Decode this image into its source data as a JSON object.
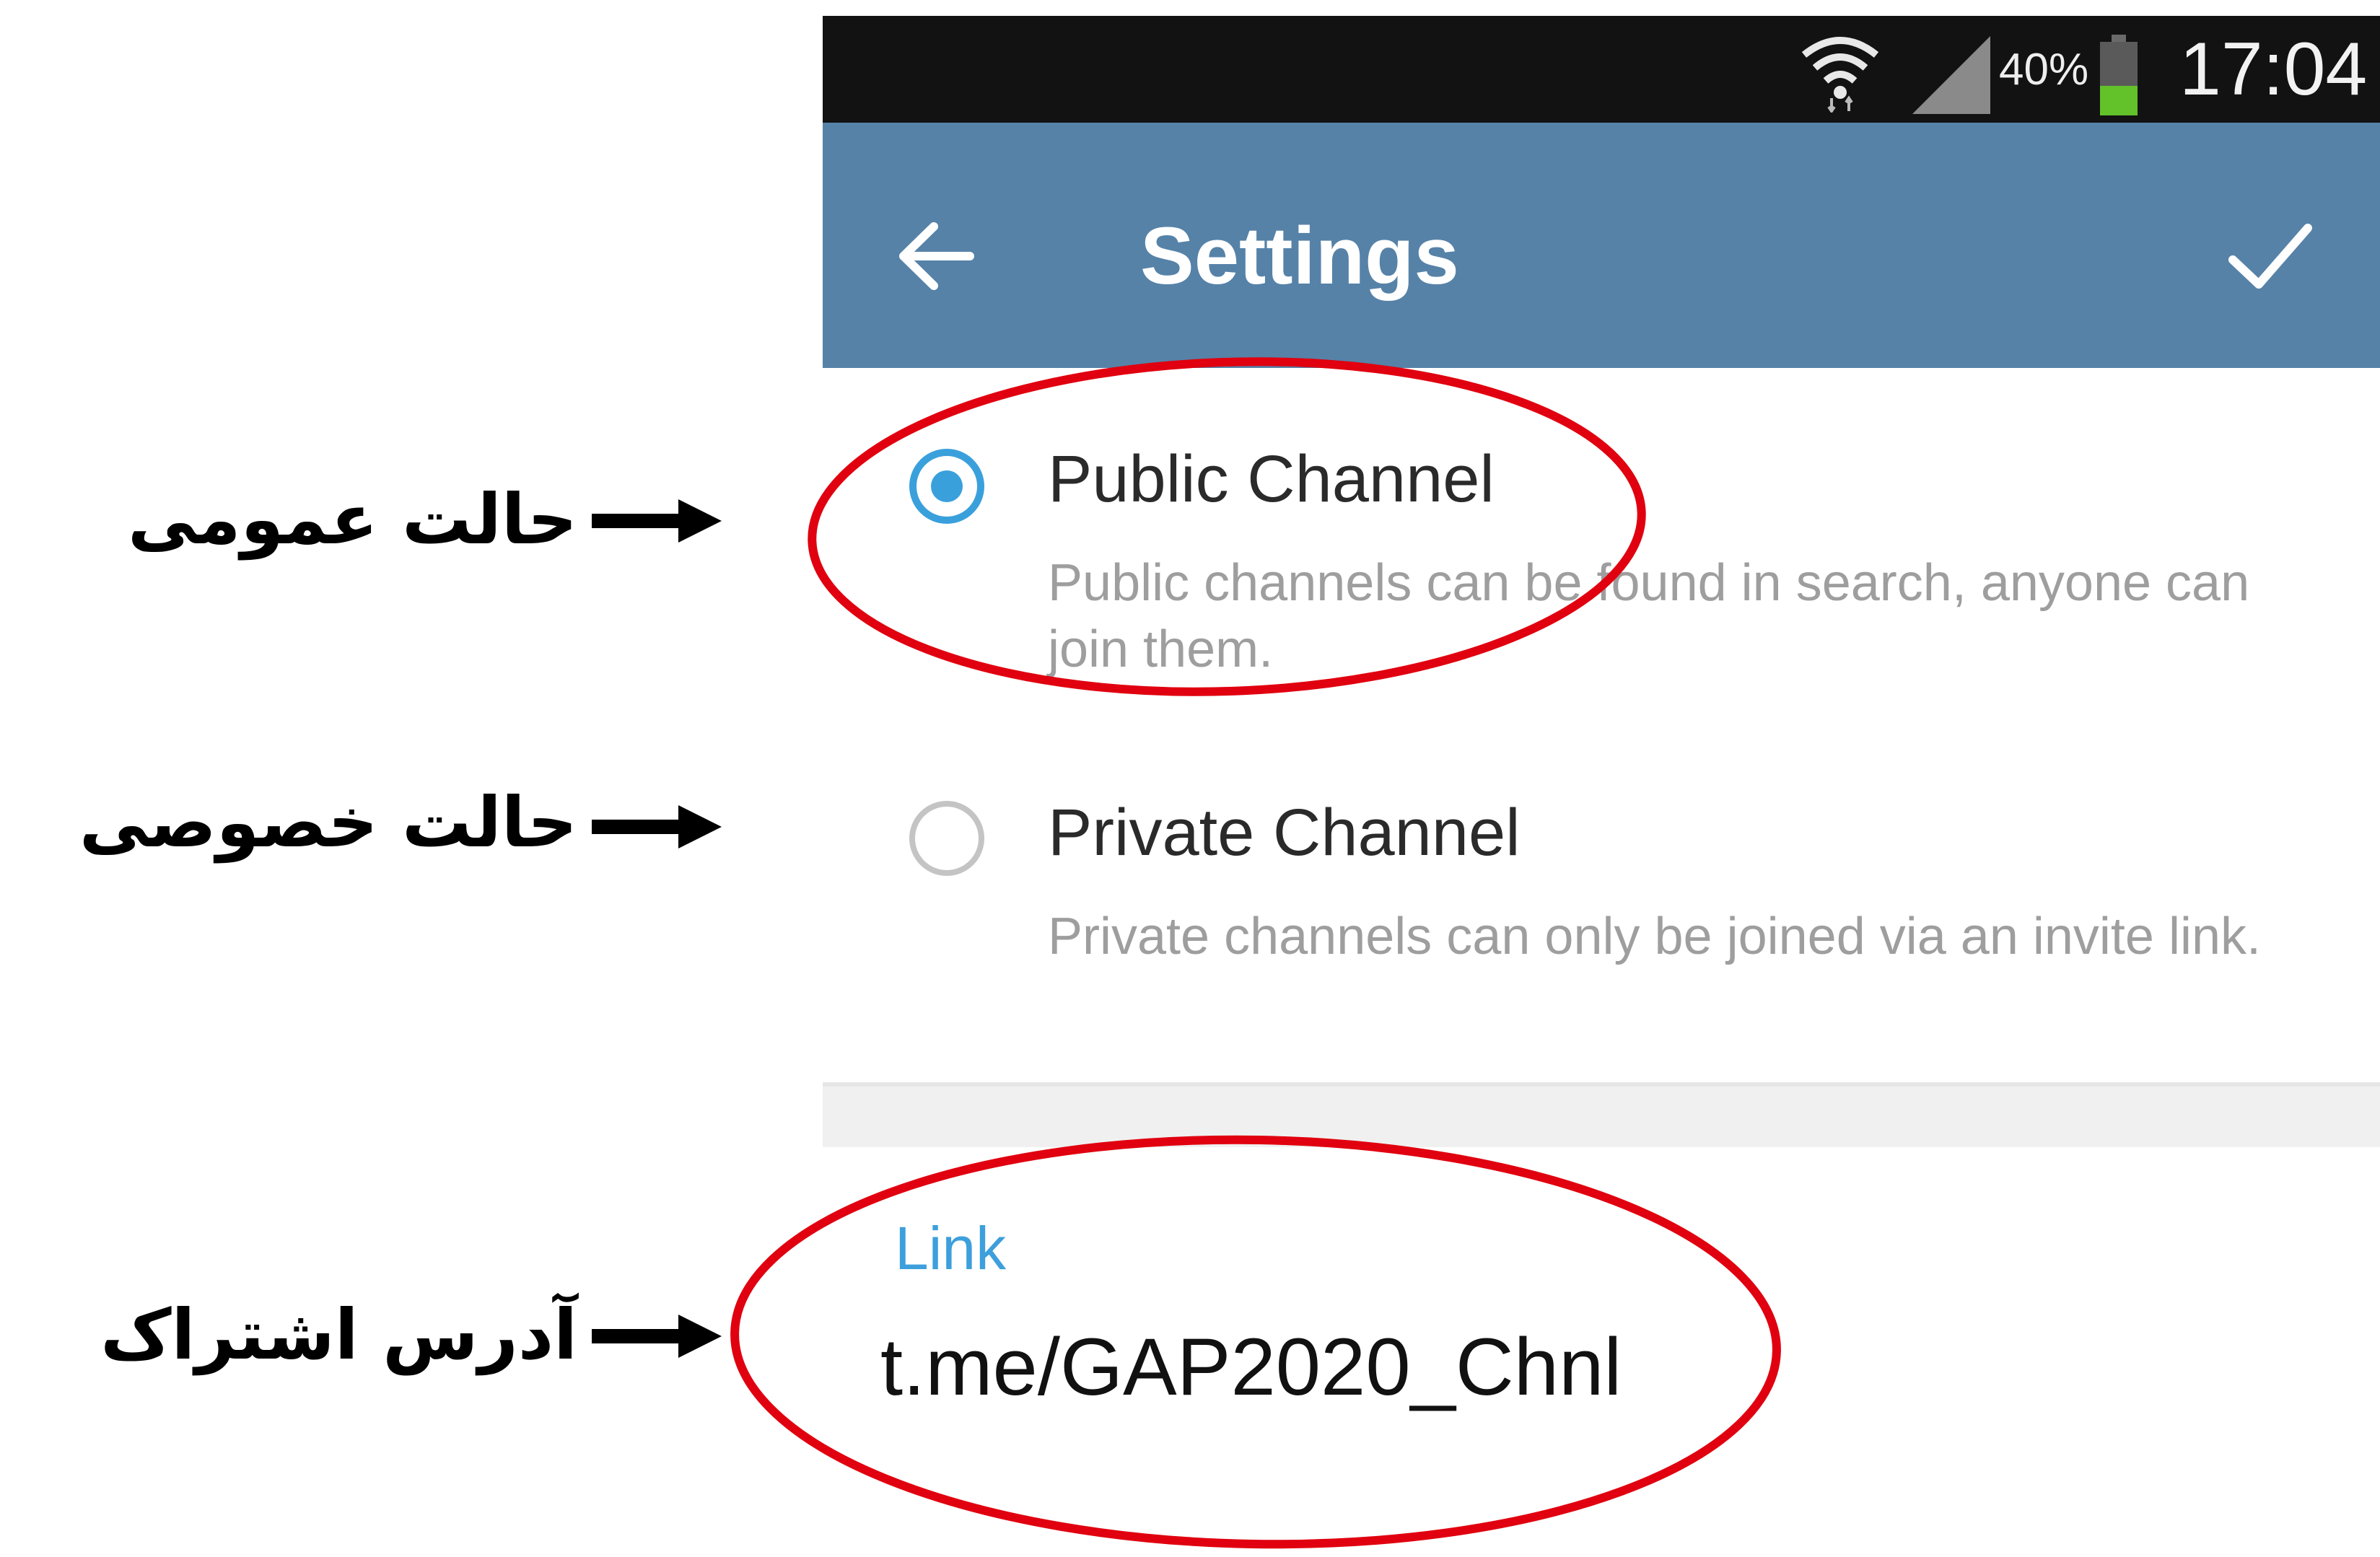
{
  "status_bar": {
    "battery_percent": "40%",
    "battery_level": 0.4,
    "time": "17:04"
  },
  "app_bar": {
    "title": "Settings"
  },
  "options": [
    {
      "title": "Public Channel",
      "description": "Public channels can be found in search, anyone can join them.",
      "selected": true
    },
    {
      "title": "Private Channel",
      "description": "Private channels can only be joined via an invite link.",
      "selected": false
    }
  ],
  "link": {
    "label": "Link",
    "value": "t.me/GAP2020_Chnl"
  },
  "annotations": {
    "public": "حالت عمومی",
    "private": "حالت خصوصی",
    "link": "آدرس اشتراک"
  },
  "colors": {
    "app_bar": "#5682a8",
    "accent": "#3aa0dc",
    "highlight_circle": "#e0000f"
  }
}
